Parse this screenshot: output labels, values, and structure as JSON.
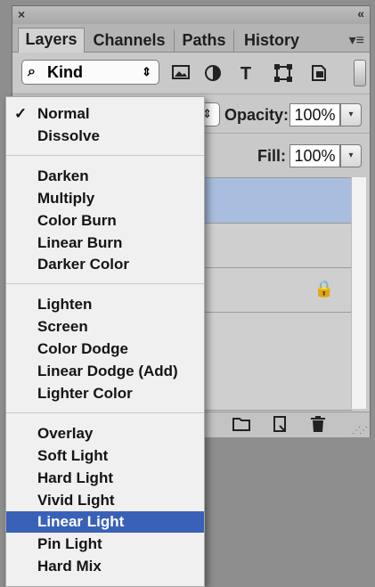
{
  "panel": {
    "close_glyph": "×",
    "collapse_glyph": "«",
    "menu_glyph": "▾≡",
    "tabs": [
      {
        "label": "Layers"
      },
      {
        "label": "Channels"
      },
      {
        "label": "Paths"
      },
      {
        "label": "History"
      }
    ],
    "filter": {
      "kind_label": "Kind",
      "search_glyph": "⌕",
      "arrows_glyph": "⇕",
      "icons": [
        "image-filter-icon",
        "adjustment-filter-icon",
        "type-filter-icon",
        "shape-filter-icon",
        "smart-object-filter-icon"
      ],
      "type_glyph": "T"
    },
    "opacity_label": "Opacity:",
    "opacity_value": "100%",
    "fill_label": "Fill:",
    "fill_value": "100%",
    "step_glyph": "▾",
    "lock_glyph": "🔒"
  },
  "blend_menu": {
    "checkmark": "✓",
    "groups": [
      [
        "Normal",
        "Dissolve"
      ],
      [
        "Darken",
        "Multiply",
        "Color Burn",
        "Linear Burn",
        "Darker Color"
      ],
      [
        "Lighten",
        "Screen",
        "Color Dodge",
        "Linear Dodge (Add)",
        "Lighter Color"
      ],
      [
        "Overlay",
        "Soft Light",
        "Hard Light",
        "Vivid Light",
        "Linear Light",
        "Pin Light",
        "Hard Mix"
      ]
    ],
    "selected": "Normal",
    "highlighted": "Linear Light",
    "highlight_color": "#3a61b8"
  }
}
